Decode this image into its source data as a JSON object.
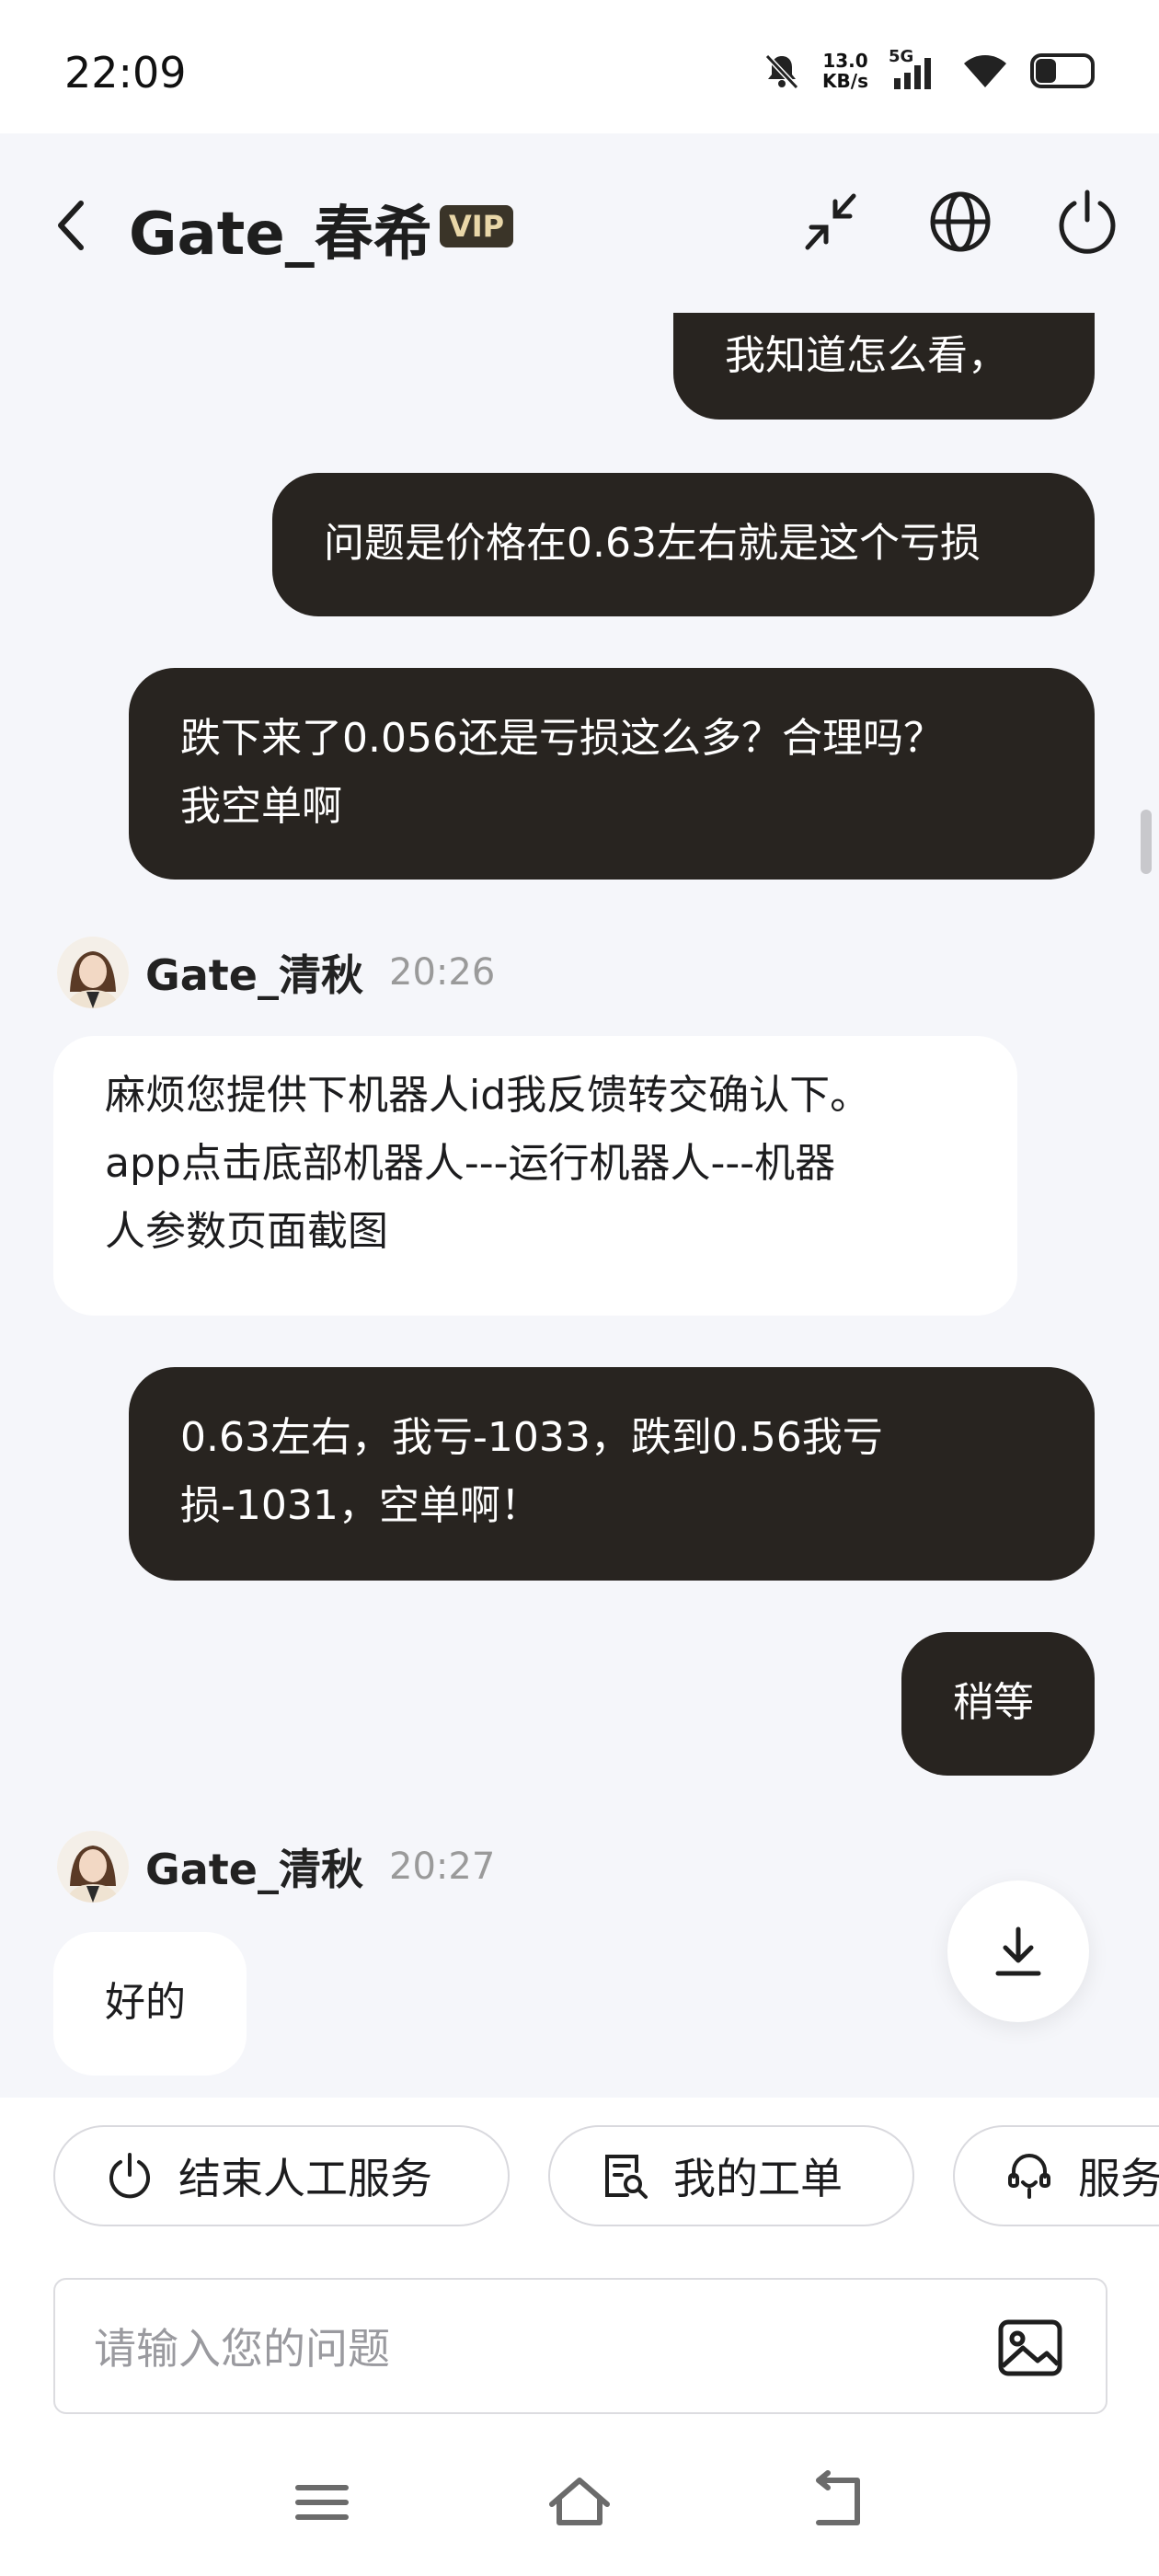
{
  "status_bar": {
    "time": "22:09",
    "net_speed_value": "13.0",
    "net_speed_unit": "KB/s",
    "network": "5G"
  },
  "header": {
    "title": "Gate_春希",
    "badge": "VIP"
  },
  "messages": {
    "out_1": "我知道怎么看，",
    "out_2": "问题是价格在0.63左右就是这个亏损",
    "out_3_line1": "跌下来了0.056还是亏损这么多？合理吗？",
    "out_3_line2": "我空单啊",
    "agent_1": {
      "name": "Gate_清秋",
      "time": "20:26"
    },
    "in_1_line1": "麻烦您提供下机器人id我反馈转交确认下。",
    "in_1_line2": "app点击底部机器人---运行机器人---机器",
    "in_1_line3": "人参数页面截图",
    "out_4_line1": "0.63左右，我亏-1033，跌到0.56我亏",
    "out_4_line2": "损-1031，空单啊！",
    "out_5": "稍等",
    "agent_2": {
      "name": "Gate_清秋",
      "time": "20:27"
    },
    "in_2": "好的"
  },
  "quick_actions": {
    "end_service": "结束人工服务",
    "my_tickets": "我的工单",
    "service": "服务"
  },
  "input": {
    "placeholder": "请输入您的问题"
  },
  "colors": {
    "out_bubble": "#282420",
    "in_bubble": "#ffffff",
    "background": "#f5f6fa",
    "vip_badge": "#3a3428"
  }
}
